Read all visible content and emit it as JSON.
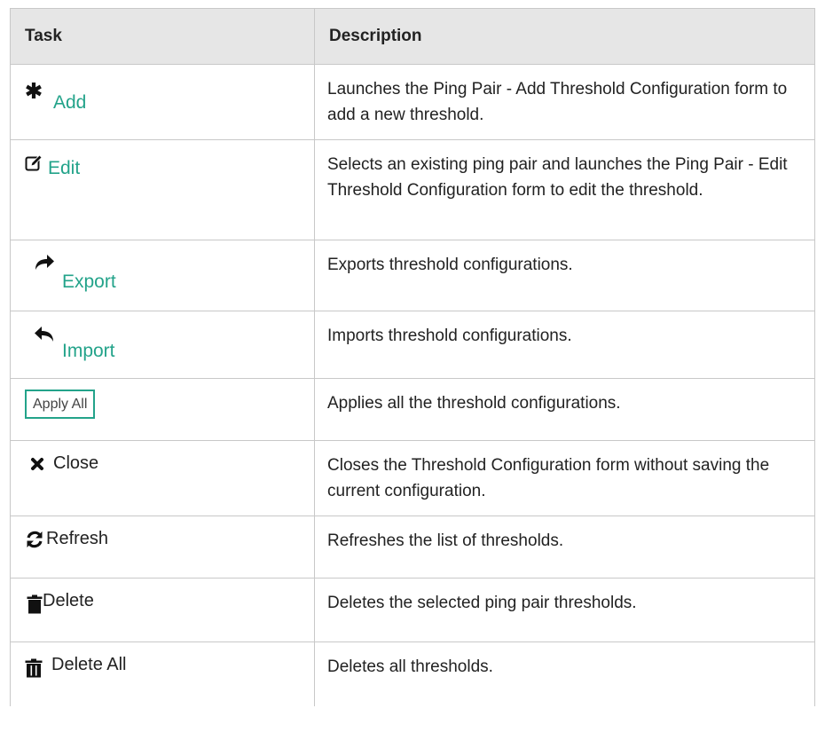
{
  "table": {
    "headers": {
      "task": "Task",
      "description": "Description"
    },
    "rows": [
      {
        "icon": "asterisk-icon",
        "task": "Add",
        "style": "link",
        "description": "Launches the Ping Pair - Add Threshold Configuration form to add a new threshold."
      },
      {
        "icon": "edit-icon",
        "task": "Edit",
        "style": "link",
        "description": "Selects an existing ping pair and launches the Ping Pair - Edit Threshold Configuration form to edit the threshold."
      },
      {
        "icon": "share-arrow-icon",
        "task": "Export",
        "style": "link",
        "description": "Exports threshold configurations."
      },
      {
        "icon": "reply-arrow-icon",
        "task": "Import",
        "style": "link",
        "description": "Imports threshold configurations."
      },
      {
        "icon": "",
        "task": "Apply All",
        "style": "button",
        "description": "Applies all the threshold configurations."
      },
      {
        "icon": "close-icon",
        "task": "Close",
        "style": "plain",
        "description": "Closes the Threshold Configuration form without saving the current configuration."
      },
      {
        "icon": "refresh-icon",
        "task": "Refresh",
        "style": "plain",
        "description": "Refreshes the list of thresholds."
      },
      {
        "icon": "trash-icon",
        "task": "Delete",
        "style": "plain",
        "description": "Deletes the selected ping pair thresholds."
      },
      {
        "icon": "trash-all-icon",
        "task": "Delete All",
        "style": "plain",
        "description": "Deletes all thresholds."
      }
    ]
  },
  "colors": {
    "link": "#23a38a",
    "header_bg": "#e6e6e6",
    "border": "#c8c8c8"
  }
}
